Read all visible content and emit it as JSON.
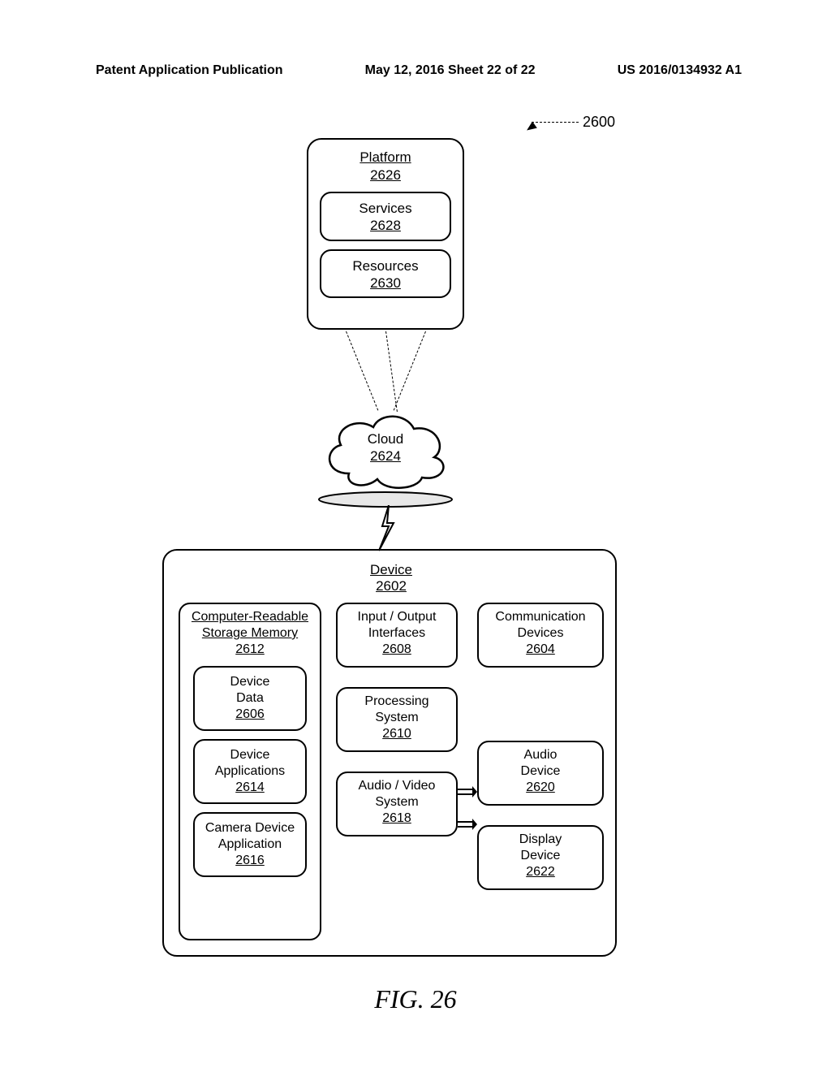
{
  "header": {
    "left": "Patent Application Publication",
    "center": "May 12, 2016  Sheet 22 of 22",
    "right": "US 2016/0134932 A1"
  },
  "figure_caption": "FIG. 26",
  "ref_label": "2600",
  "platform": {
    "title": "Platform",
    "number": "2626",
    "services": {
      "label": "Services",
      "number": "2628"
    },
    "resources": {
      "label": "Resources",
      "number": "2630"
    }
  },
  "cloud": {
    "label": "Cloud",
    "number": "2624"
  },
  "device": {
    "title": "Device",
    "number": "2602",
    "crsm": {
      "title_line1": "Computer-Readable",
      "title_line2": "Storage Memory",
      "number": "2612",
      "device_data": {
        "line1": "Device",
        "line2": "Data",
        "number": "2606"
      },
      "device_apps": {
        "line1": "Device",
        "line2": "Applications",
        "number": "2614"
      },
      "camera_app": {
        "line1": "Camera Device",
        "line2": "Application",
        "number": "2616"
      }
    },
    "io": {
      "line1": "Input / Output",
      "line2": "Interfaces",
      "number": "2608"
    },
    "proc": {
      "line1": "Processing",
      "line2": "System",
      "number": "2610"
    },
    "av": {
      "line1": "Audio / Video",
      "line2": "System",
      "number": "2618"
    },
    "comm": {
      "line1": "Communication",
      "line2": "Devices",
      "number": "2604"
    },
    "audio": {
      "line1": "Audio",
      "line2": "Device",
      "number": "2620"
    },
    "display": {
      "line1": "Display",
      "line2": "Device",
      "number": "2622"
    }
  }
}
